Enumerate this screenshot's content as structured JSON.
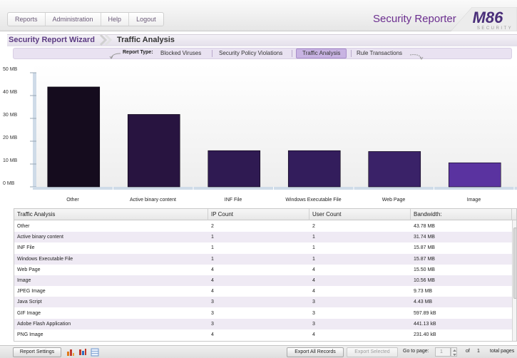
{
  "top_menu": [
    "Reports",
    "Administration",
    "Help",
    "Logout"
  ],
  "app_title": "Security Reporter",
  "logo": {
    "main": "M86",
    "sub": "SECURITY"
  },
  "breadcrumb": {
    "wizard": "Security Report Wizard",
    "current": "Traffic Analysis"
  },
  "report_type": {
    "label": "Report Type:",
    "items": [
      "Blocked Viruses",
      "Security Policy Violations",
      "Traffic Analysis",
      "Rule Transactions"
    ],
    "active": "Traffic Analysis"
  },
  "chart_data": {
    "type": "bar",
    "categories": [
      "Other",
      "Active binary content",
      "INF File",
      "Windows Executable File",
      "Web Page",
      "Image"
    ],
    "values": [
      43.78,
      31.74,
      15.87,
      15.87,
      15.5,
      10.56
    ],
    "ylabel": "",
    "ylim": [
      0,
      50
    ],
    "yticks": [
      "0 MB",
      "10 MB",
      "20 MB",
      "30 MB",
      "40 MB",
      "50 MB"
    ],
    "grid": false,
    "colors": [
      "#150c1e",
      "#281440",
      "#2f1a52",
      "#331d5c",
      "#3a2268",
      "#5a33a0"
    ]
  },
  "table": {
    "headers": [
      "Traffic Analysis",
      "IP Count",
      "User Count",
      "Bandwidth:"
    ],
    "rows": [
      [
        "Other",
        "2",
        "2",
        "43.78 MB"
      ],
      [
        "Active binary content",
        "1",
        "1",
        "31.74 MB"
      ],
      [
        "INF File",
        "1",
        "1",
        "15.87 MB"
      ],
      [
        "Windows Executable File",
        "1",
        "1",
        "15.87 MB"
      ],
      [
        "Web Page",
        "4",
        "4",
        "15.50 MB"
      ],
      [
        "Image",
        "4",
        "4",
        "10.56 MB"
      ],
      [
        "JPEG Image",
        "4",
        "4",
        "9.73 MB"
      ],
      [
        "Java Script",
        "3",
        "3",
        "4.43 MB"
      ],
      [
        "GIF Image",
        "3",
        "3",
        "597.89 kB"
      ],
      [
        "Adobe Flash Application",
        "3",
        "3",
        "441.13 kB"
      ],
      [
        "PNG Image",
        "4",
        "4",
        "231.40 kB"
      ]
    ]
  },
  "bottom": {
    "report_settings": "Report Settings",
    "export_all": "Export All Records",
    "export_selected": "Export Selected",
    "goto_label": "Go to page:",
    "goto_value": "1",
    "of_label": "of",
    "total_pages": "1",
    "total_pages_label": "total pages"
  },
  "icons": [
    "bar-chart-icon",
    "column-chart-icon",
    "table-view-icon"
  ]
}
